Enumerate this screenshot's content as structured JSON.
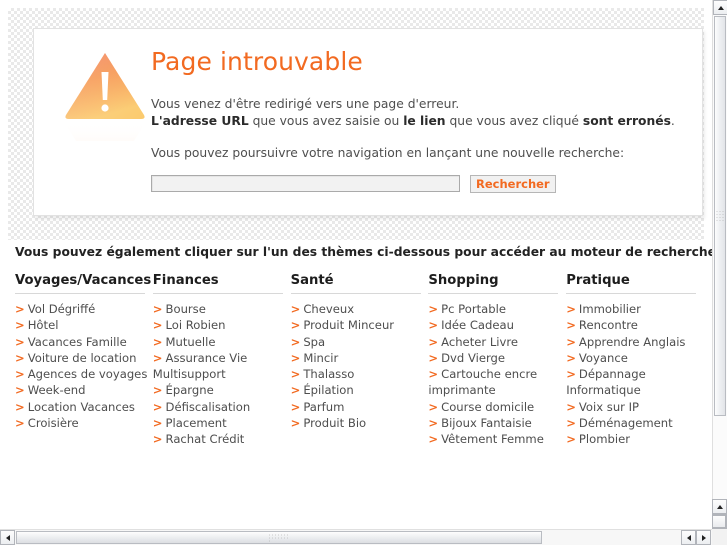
{
  "error": {
    "icon": "warning-triangle-icon",
    "title": "Page introuvable",
    "para1_line1": "Vous venez d'être redirigé vers une page d'erreur.",
    "para1_line2_b1": "L'adresse URL",
    "para1_line2_t1": " que vous avez saisie ou ",
    "para1_line2_b2": "le lien",
    "para1_line2_t2": " que vous avez cliqué ",
    "para1_line2_b3": "sont erronés",
    "para1_line2_t3": ".",
    "para2": "Vous pouvez poursuivre votre navigation en lançant une nouvelle recherche:",
    "search_value": "",
    "search_placeholder": "",
    "search_button": "Rechercher"
  },
  "themes": {
    "intro": "Vous pouvez également cliquer sur l'un des thèmes ci-dessous pour accéder au moteur de recherche :",
    "columns": [
      {
        "heading": "Voyages/Vacances",
        "links": [
          "Vol Dégriffé",
          "Hôtel",
          "Vacances Famille",
          "Voiture de location",
          "Agences de voyages",
          "Week-end",
          "Location Vacances",
          "Croisière"
        ]
      },
      {
        "heading": "Finances",
        "links": [
          "Bourse",
          "Loi Robien",
          "Mutuelle",
          "Assurance Vie Multisupport",
          "Épargne",
          "Défiscalisation",
          "Placement",
          "Rachat Crédit"
        ]
      },
      {
        "heading": "Santé",
        "links": [
          "Cheveux",
          "Produit Minceur",
          "Spa",
          "Mincir",
          "Thalasso",
          "Épilation",
          "Parfum",
          "Produit Bio"
        ]
      },
      {
        "heading": "Shopping",
        "links": [
          "Pc Portable",
          "Idée Cadeau",
          "Acheter Livre",
          "Dvd Vierge",
          "Cartouche encre imprimante",
          "Course domicile",
          "Bijoux Fantaisie",
          "Vêtement Femme"
        ]
      },
      {
        "heading": "Pratique",
        "links": [
          "Immobilier",
          "Rencontre",
          "Apprendre Anglais",
          "Voyance",
          "Dépannage Informatique",
          "Voix sur IP",
          "Déménagement",
          "Plombier"
        ]
      }
    ]
  },
  "colors": {
    "accent_orange": "#f26a21",
    "body_text": "#4e4e4e",
    "heading_text": "#1d1d1d"
  },
  "scrollbars": {
    "vertical_up_icon": "triangle-up-icon",
    "vertical_down_icon": "triangle-down-icon",
    "horizontal_left_icon": "triangle-left-icon",
    "horizontal_right_icon": "triangle-right-icon"
  }
}
